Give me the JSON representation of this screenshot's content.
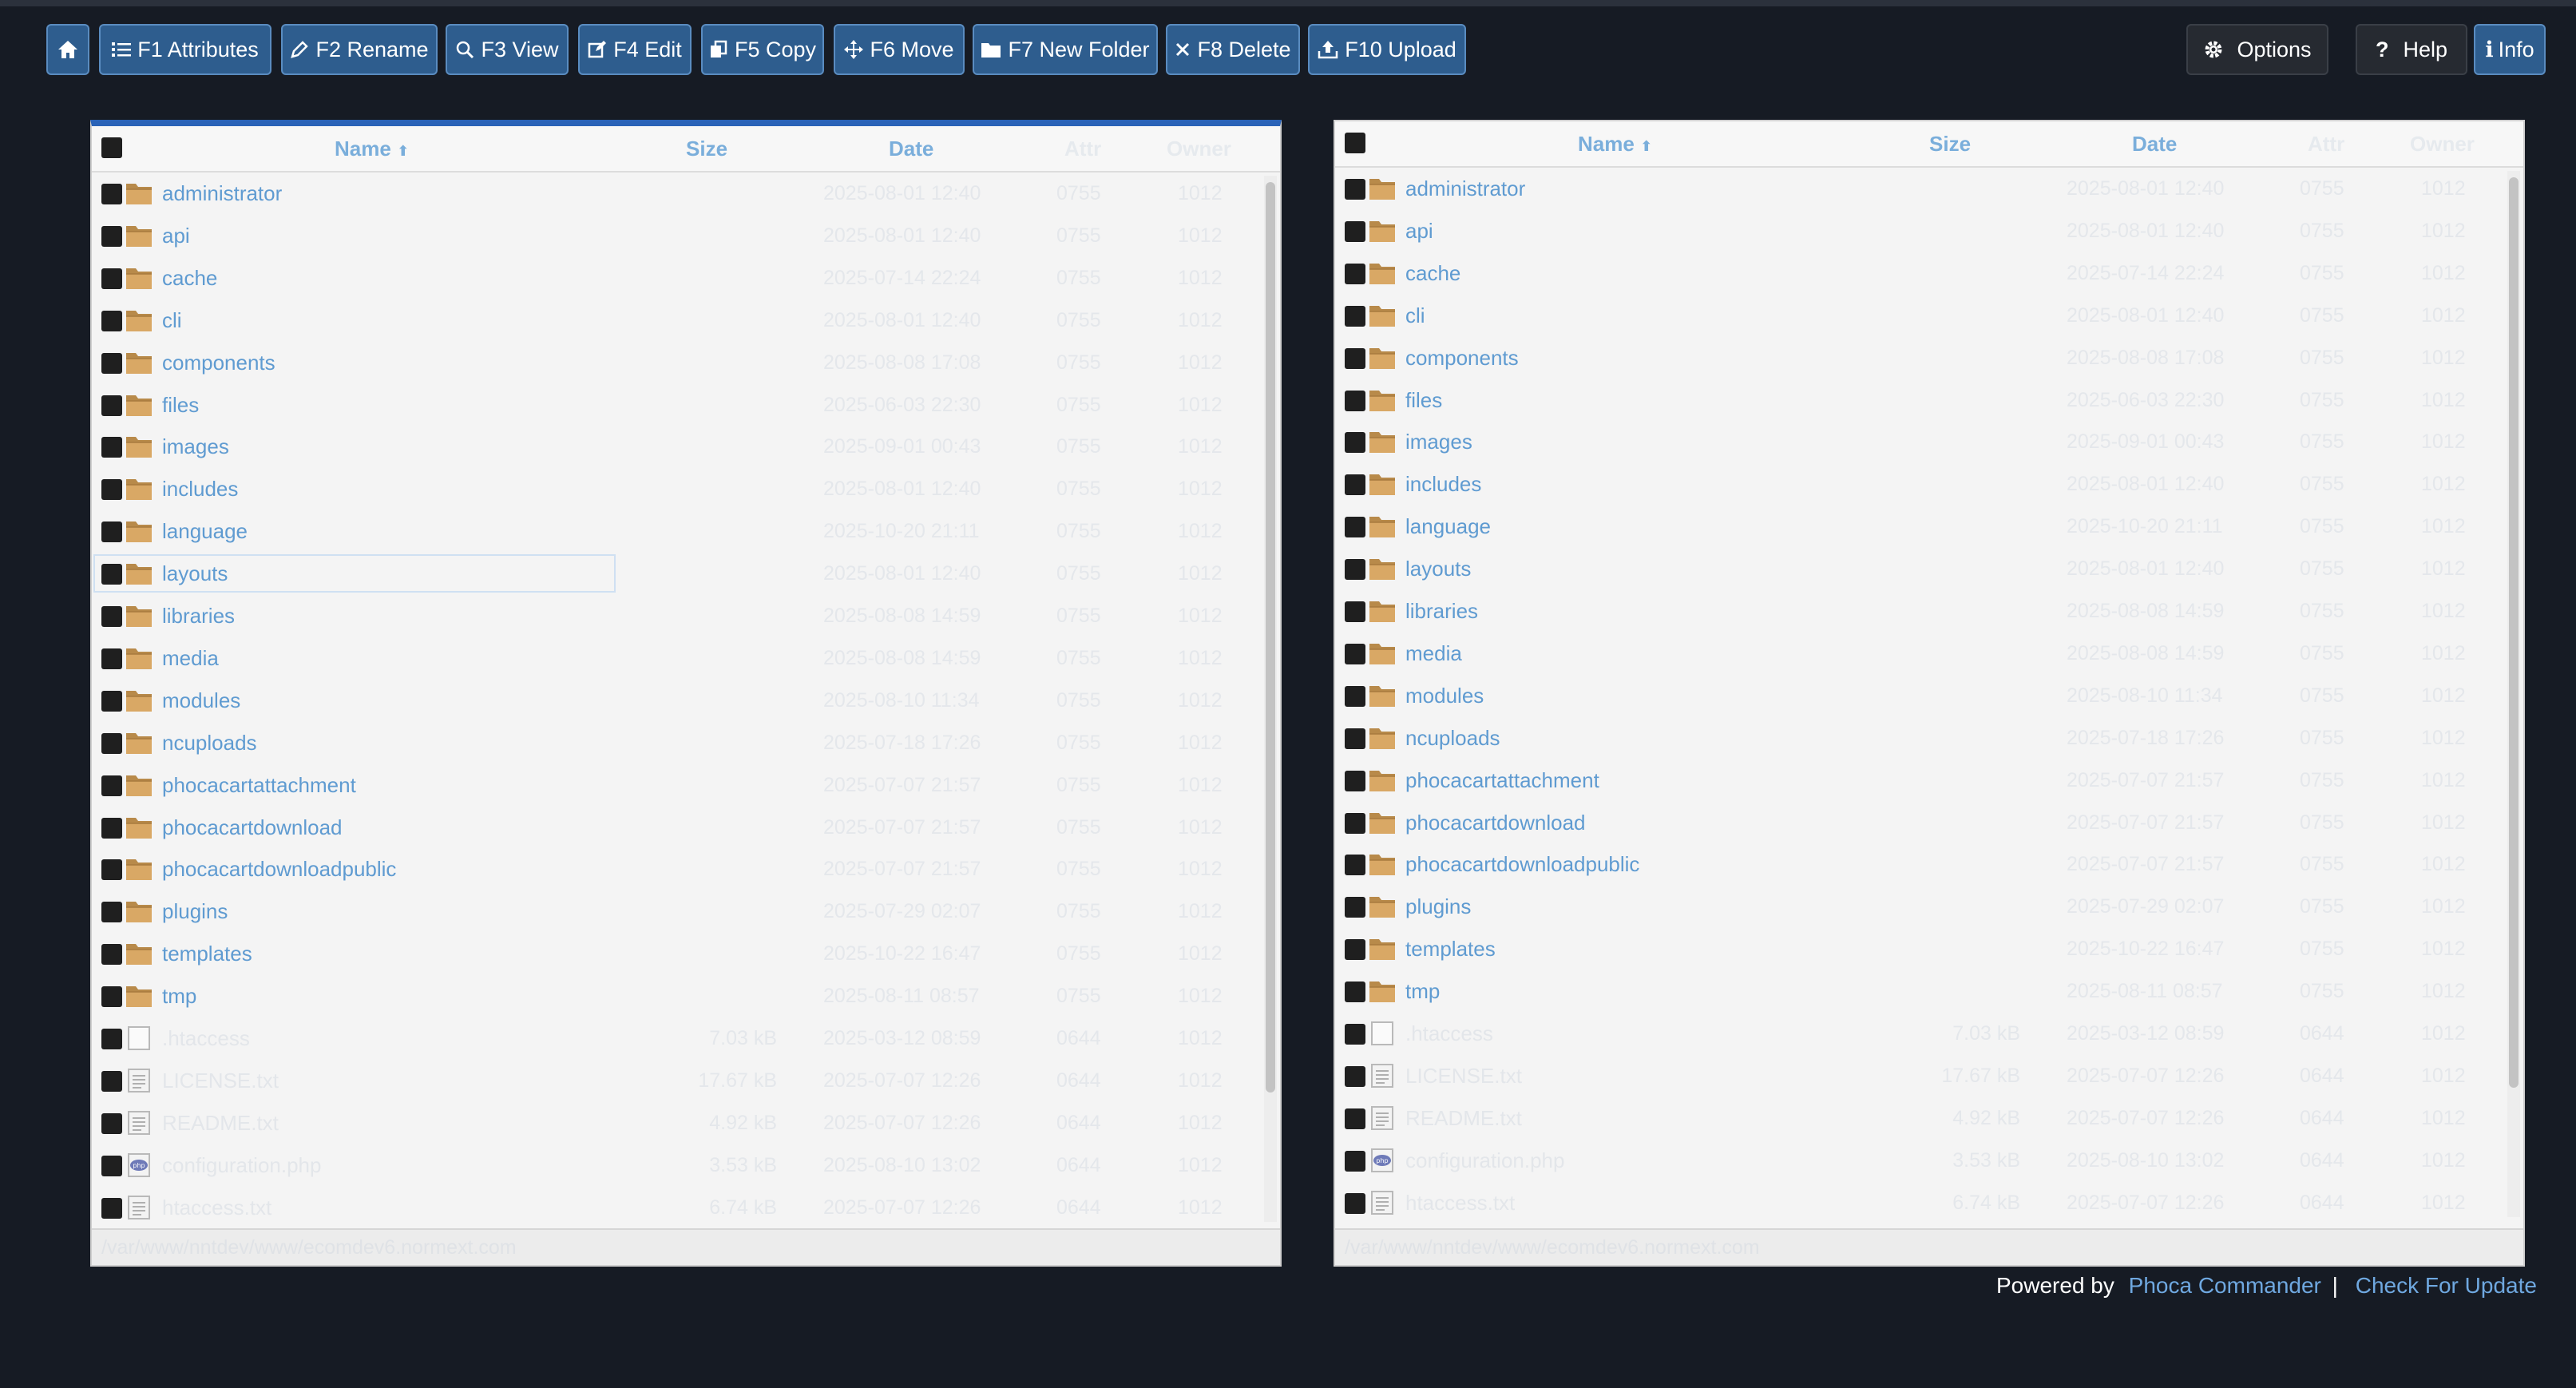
{
  "toolbar": {
    "home_label": "",
    "attributes": "F1 Attributes",
    "rename": "F2 Rename",
    "view": "F3 View",
    "edit": "F4 Edit",
    "copy": "F5 Copy",
    "move": "F6 Move",
    "new_folder": "F7 New Folder",
    "delete": "F8 Delete",
    "upload": "F10 Upload",
    "options": "Options",
    "help": "Help",
    "info": "Info"
  },
  "columns": {
    "name": "Name",
    "size": "Size",
    "date": "Date",
    "attr": "Attr",
    "owner": "Owner"
  },
  "left_panel": {
    "rows": [
      {
        "name": "administrator",
        "type": "folder",
        "size": "",
        "date": "2025-08-01 12:40",
        "attr": "0755",
        "owner": "1012"
      },
      {
        "name": "api",
        "type": "folder",
        "size": "",
        "date": "2025-08-01 12:40",
        "attr": "0755",
        "owner": "1012"
      },
      {
        "name": "cache",
        "type": "folder",
        "size": "",
        "date": "2025-07-14 22:24",
        "attr": "0755",
        "owner": "1012"
      },
      {
        "name": "cli",
        "type": "folder",
        "size": "",
        "date": "2025-08-01 12:40",
        "attr": "0755",
        "owner": "1012"
      },
      {
        "name": "components",
        "type": "folder",
        "size": "",
        "date": "2025-08-08 17:08",
        "attr": "0755",
        "owner": "1012"
      },
      {
        "name": "files",
        "type": "folder",
        "size": "",
        "date": "2025-06-03 22:30",
        "attr": "0755",
        "owner": "1012"
      },
      {
        "name": "images",
        "type": "folder",
        "size": "",
        "date": "2025-09-01 00:43",
        "attr": "0755",
        "owner": "1012"
      },
      {
        "name": "includes",
        "type": "folder",
        "size": "",
        "date": "2025-08-01 12:40",
        "attr": "0755",
        "owner": "1012"
      },
      {
        "name": "language",
        "type": "folder",
        "size": "",
        "date": "2025-10-20 21:11",
        "attr": "0755",
        "owner": "1012"
      },
      {
        "name": "layouts",
        "type": "folder",
        "size": "",
        "date": "2025-08-01 12:40",
        "attr": "0755",
        "owner": "1012",
        "selected": true
      },
      {
        "name": "libraries",
        "type": "folder",
        "size": "",
        "date": "2025-08-08 14:59",
        "attr": "0755",
        "owner": "1012"
      },
      {
        "name": "media",
        "type": "folder",
        "size": "",
        "date": "2025-08-08 14:59",
        "attr": "0755",
        "owner": "1012"
      },
      {
        "name": "modules",
        "type": "folder",
        "size": "",
        "date": "2025-08-10 11:34",
        "attr": "0755",
        "owner": "1012"
      },
      {
        "name": "ncuploads",
        "type": "folder",
        "size": "",
        "date": "2025-07-18 17:26",
        "attr": "0755",
        "owner": "1012"
      },
      {
        "name": "phocacartattachment",
        "type": "folder",
        "size": "",
        "date": "2025-07-07 21:57",
        "attr": "0755",
        "owner": "1012"
      },
      {
        "name": "phocacartdownload",
        "type": "folder",
        "size": "",
        "date": "2025-07-07 21:57",
        "attr": "0755",
        "owner": "1012"
      },
      {
        "name": "phocacartdownloadpublic",
        "type": "folder",
        "size": "",
        "date": "2025-07-07 21:57",
        "attr": "0755",
        "owner": "1012"
      },
      {
        "name": "plugins",
        "type": "folder",
        "size": "",
        "date": "2025-07-29 02:07",
        "attr": "0755",
        "owner": "1012"
      },
      {
        "name": "templates",
        "type": "folder",
        "size": "",
        "date": "2025-10-22 16:47",
        "attr": "0755",
        "owner": "1012"
      },
      {
        "name": "tmp",
        "type": "folder",
        "size": "",
        "date": "2025-08-11 08:57",
        "attr": "0755",
        "owner": "1012"
      },
      {
        "name": ".htaccess",
        "type": "file",
        "size": "7.03 kB",
        "date": "2025-03-12 08:59",
        "attr": "0644",
        "owner": "1012"
      },
      {
        "name": "LICENSE.txt",
        "type": "text",
        "size": "17.67 kB",
        "date": "2025-07-07 12:26",
        "attr": "0644",
        "owner": "1012"
      },
      {
        "name": "README.txt",
        "type": "text",
        "size": "4.92 kB",
        "date": "2025-07-07 12:26",
        "attr": "0644",
        "owner": "1012"
      },
      {
        "name": "configuration.php",
        "type": "php",
        "size": "3.53 kB",
        "date": "2025-08-10 13:02",
        "attr": "0644",
        "owner": "1012"
      },
      {
        "name": "htaccess.txt",
        "type": "text",
        "size": "6.74 kB",
        "date": "2025-07-07 12:26",
        "attr": "0644",
        "owner": "1012"
      }
    ],
    "path": "/var/www/nntdev/www/ecomdev6.normext.com"
  },
  "right_panel": {
    "rows": [
      {
        "name": "administrator",
        "type": "folder",
        "size": "",
        "date": "2025-08-01 12:40",
        "attr": "0755",
        "owner": "1012"
      },
      {
        "name": "api",
        "type": "folder",
        "size": "",
        "date": "2025-08-01 12:40",
        "attr": "0755",
        "owner": "1012"
      },
      {
        "name": "cache",
        "type": "folder",
        "size": "",
        "date": "2025-07-14 22:24",
        "attr": "0755",
        "owner": "1012"
      },
      {
        "name": "cli",
        "type": "folder",
        "size": "",
        "date": "2025-08-01 12:40",
        "attr": "0755",
        "owner": "1012"
      },
      {
        "name": "components",
        "type": "folder",
        "size": "",
        "date": "2025-08-08 17:08",
        "attr": "0755",
        "owner": "1012"
      },
      {
        "name": "files",
        "type": "folder",
        "size": "",
        "date": "2025-06-03 22:30",
        "attr": "0755",
        "owner": "1012"
      },
      {
        "name": "images",
        "type": "folder",
        "size": "",
        "date": "2025-09-01 00:43",
        "attr": "0755",
        "owner": "1012"
      },
      {
        "name": "includes",
        "type": "folder",
        "size": "",
        "date": "2025-08-01 12:40",
        "attr": "0755",
        "owner": "1012"
      },
      {
        "name": "language",
        "type": "folder",
        "size": "",
        "date": "2025-10-20 21:11",
        "attr": "0755",
        "owner": "1012"
      },
      {
        "name": "layouts",
        "type": "folder",
        "size": "",
        "date": "2025-08-01 12:40",
        "attr": "0755",
        "owner": "1012"
      },
      {
        "name": "libraries",
        "type": "folder",
        "size": "",
        "date": "2025-08-08 14:59",
        "attr": "0755",
        "owner": "1012"
      },
      {
        "name": "media",
        "type": "folder",
        "size": "",
        "date": "2025-08-08 14:59",
        "attr": "0755",
        "owner": "1012"
      },
      {
        "name": "modules",
        "type": "folder",
        "size": "",
        "date": "2025-08-10 11:34",
        "attr": "0755",
        "owner": "1012"
      },
      {
        "name": "ncuploads",
        "type": "folder",
        "size": "",
        "date": "2025-07-18 17:26",
        "attr": "0755",
        "owner": "1012"
      },
      {
        "name": "phocacartattachment",
        "type": "folder",
        "size": "",
        "date": "2025-07-07 21:57",
        "attr": "0755",
        "owner": "1012"
      },
      {
        "name": "phocacartdownload",
        "type": "folder",
        "size": "",
        "date": "2025-07-07 21:57",
        "attr": "0755",
        "owner": "1012"
      },
      {
        "name": "phocacartdownloadpublic",
        "type": "folder",
        "size": "",
        "date": "2025-07-07 21:57",
        "attr": "0755",
        "owner": "1012"
      },
      {
        "name": "plugins",
        "type": "folder",
        "size": "",
        "date": "2025-07-29 02:07",
        "attr": "0755",
        "owner": "1012"
      },
      {
        "name": "templates",
        "type": "folder",
        "size": "",
        "date": "2025-10-22 16:47",
        "attr": "0755",
        "owner": "1012"
      },
      {
        "name": "tmp",
        "type": "folder",
        "size": "",
        "date": "2025-08-11 08:57",
        "attr": "0755",
        "owner": "1012"
      },
      {
        "name": ".htaccess",
        "type": "file",
        "size": "7.03 kB",
        "date": "2025-03-12 08:59",
        "attr": "0644",
        "owner": "1012"
      },
      {
        "name": "LICENSE.txt",
        "type": "text",
        "size": "17.67 kB",
        "date": "2025-07-07 12:26",
        "attr": "0644",
        "owner": "1012"
      },
      {
        "name": "README.txt",
        "type": "text",
        "size": "4.92 kB",
        "date": "2025-07-07 12:26",
        "attr": "0644",
        "owner": "1012"
      },
      {
        "name": "configuration.php",
        "type": "php",
        "size": "3.53 kB",
        "date": "2025-08-10 13:02",
        "attr": "0644",
        "owner": "1012"
      },
      {
        "name": "htaccess.txt",
        "type": "text",
        "size": "6.74 kB",
        "date": "2025-07-07 12:26",
        "attr": "0644",
        "owner": "1012"
      }
    ],
    "path": "/var/www/nntdev/www/ecomdev6.normext.com"
  },
  "footer": {
    "powered_by": "Powered by",
    "product_link": "Phoca Commander",
    "separator": "|",
    "update_link": "Check For Update"
  },
  "colors": {
    "background": "#161b24",
    "button": "#2e5d8e",
    "link": "#5f9bd1",
    "active_border": "#2a63b8"
  }
}
